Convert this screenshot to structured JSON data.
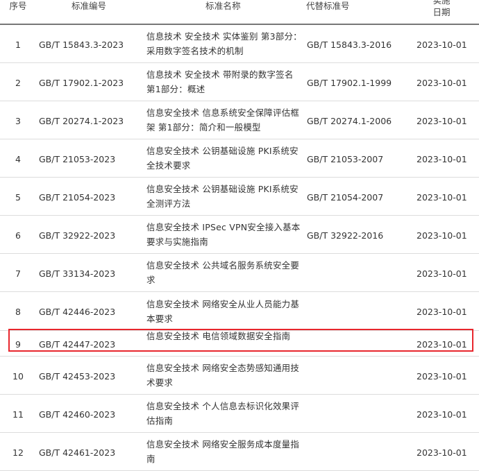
{
  "headers": {
    "no": "序号",
    "code": "标准编号",
    "name": "标准名称",
    "replaced": "代替标准号",
    "date_line1": "实施",
    "date_line2": "日期"
  },
  "rows": [
    {
      "no": "1",
      "code": "GB/T 15843.3-2023",
      "name": "信息技术 安全技术 实体鉴别 第3部分：采用数字签名技术的机制",
      "replaced": "GB/T 15843.3-2016",
      "date": "2023-10-01"
    },
    {
      "no": "2",
      "code": "GB/T 17902.1-2023",
      "name": "信息技术 安全技术 带附录的数字签名 第1部分：概述",
      "replaced": "GB/T 17902.1-1999",
      "date": "2023-10-01"
    },
    {
      "no": "3",
      "code": "GB/T 20274.1-2023",
      "name": "信息安全技术 信息系统安全保障评估框架 第1部分：简介和一般模型",
      "replaced": "GB/T 20274.1-2006",
      "date": "2023-10-01"
    },
    {
      "no": "4",
      "code": "GB/T 21053-2023",
      "name": "信息安全技术 公钥基础设施 PKI系统安全技术要求",
      "replaced": "GB/T 21053-2007",
      "date": "2023-10-01"
    },
    {
      "no": "5",
      "code": "GB/T 21054-2023",
      "name": "信息安全技术 公钥基础设施 PKI系统安全测评方法",
      "replaced": "GB/T 21054-2007",
      "date": "2023-10-01"
    },
    {
      "no": "6",
      "code": "GB/T 32922-2023",
      "name": "信息安全技术 IPSec VPN安全接入基本要求与实施指南",
      "replaced": "GB/T 32922-2016",
      "date": "2023-10-01"
    },
    {
      "no": "7",
      "code": "GB/T 33134-2023",
      "name": "信息安全技术 公共域名服务系统安全要求",
      "replaced": "",
      "date": "2023-10-01"
    },
    {
      "no": "8",
      "code": "GB/T 42446-2023",
      "name": "信息安全技术 网络安全从业人员能力基本要求",
      "replaced": "",
      "date": "2023-10-01"
    },
    {
      "no": "9",
      "code": "GB/T 42447-2023",
      "name": "信息安全技术 电信领域数据安全指南",
      "replaced": "",
      "date": "2023-10-01"
    },
    {
      "no": "10",
      "code": "GB/T 42453-2023",
      "name": "信息安全技术 网络安全态势感知通用技术要求",
      "replaced": "",
      "date": "2023-10-01"
    },
    {
      "no": "11",
      "code": "GB/T 42460-2023",
      "name": "信息安全技术 个人信息去标识化效果评估指南",
      "replaced": "",
      "date": "2023-10-01"
    },
    {
      "no": "12",
      "code": "GB/T 42461-2023",
      "name": "信息安全技术 网络安全服务成本度量指南",
      "replaced": "",
      "date": "2023-10-01"
    }
  ],
  "highlight_color": "#e8262d"
}
